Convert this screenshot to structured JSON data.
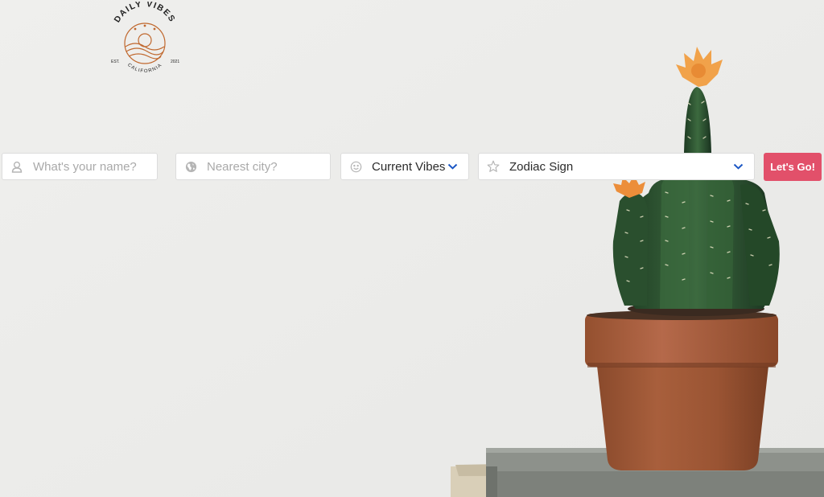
{
  "brand": {
    "name": "DAILY VIBES",
    "est": "EST.",
    "year": "2021",
    "location": "CALIFORNIA",
    "accent": "#c0682e"
  },
  "form": {
    "name_field": {
      "placeholder": "What's your name?",
      "icon": "person-icon"
    },
    "city_field": {
      "placeholder": "Nearest city?",
      "icon": "globe-icon"
    },
    "vibes_select": {
      "value": "Current Vibes",
      "icon": "smiley-icon"
    },
    "zodiac_select": {
      "value": "Zodiac Sign",
      "icon": "star-icon"
    },
    "submit_label": "Let's Go!"
  },
  "colors": {
    "background": "#ededeb",
    "button": "#e2506a",
    "chevron": "#1a56c4"
  }
}
